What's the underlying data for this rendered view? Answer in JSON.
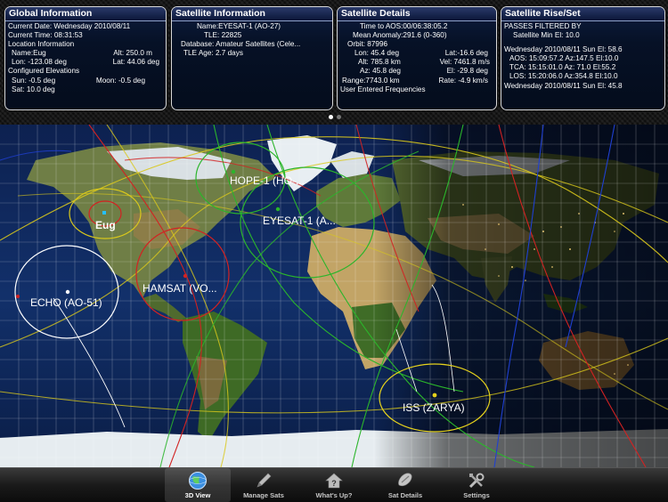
{
  "panels": {
    "global": {
      "title": "Global Information",
      "current_date": "Current Date: Wednesday 2010/08/11",
      "current_time": "Current Time: 08:31:53",
      "location_header": "Location Information",
      "name": "Name:Eug",
      "alt": "Alt:     250.0 m",
      "lon": "Lon: -123.08 deg",
      "lat": "Lat: 44.06 deg",
      "elev_header": "Configured Elevations",
      "sun": "Sun:  -0.5 deg",
      "moon": "Moon:  -0.5 deg",
      "sat": "Sat:  10.0 deg"
    },
    "satinfo": {
      "title": "Satellite Information",
      "name": "Name:EYESAT-1 (AO-27)",
      "tle": "TLE: 22825",
      "database": "Database: Amateur Satellites (Cele...",
      "tle_age": "TLE Age: 2.7 days"
    },
    "details": {
      "title": "Satellite Details",
      "time_to_aos": "Time to AOS:00/06:38:05.2",
      "mean_anomaly": "Mean Anomaly:291.6 (0-360)",
      "orbit": "Orbit:  87996",
      "lon": "Lon:  45.4 deg",
      "lat": "Lat:-16.6 deg",
      "alt": "Alt:  785.8 km",
      "vel": "Vel: 7461.8 m/s",
      "az": "Az: 45.8 deg",
      "el": "El: -29.8 deg",
      "range": "Range:7743.0 km",
      "rate": "Rate:   -4.9 km/s",
      "user_freq": "User Entered Frequencies"
    },
    "riseset": {
      "title": "Satellite Rise/Set",
      "filtered": "PASSES FILTERED BY",
      "min_el": "Satellite Min El:  10.0",
      "pass1": "Wednesday 2010/08/11 Sun El: 58.6",
      "aos1": "AOS: 15:09:57.2 Az:147.5 El:10.0",
      "tca1": "TCA: 15:15:01.0 Az: 71.0 El:55.2",
      "los1": "LOS: 15:20:06.0 Az:354.8 El:10.0",
      "pass2": "Wednesday 2010/08/11 Sun El: 45.8"
    }
  },
  "map": {
    "location_label": "Eug",
    "satellites": [
      {
        "name": "HOPE-1 (HO-...",
        "color": "#1f7a1f"
      },
      {
        "name": "EYESAT-1 (A...",
        "color": "#22aa22"
      },
      {
        "name": "HAMSAT (VO...",
        "color": "#d22222"
      },
      {
        "name": "ECHO (AO-51)",
        "color": "#ffffff"
      },
      {
        "name": "ISS (ZARYA)",
        "color": "#e6d21c"
      }
    ]
  },
  "tabs": [
    {
      "label": "3D View",
      "icon": "globe-icon",
      "selected": true
    },
    {
      "label": "Manage Sats",
      "icon": "pencil-icon"
    },
    {
      "label": "What's Up?",
      "icon": "house-question-icon"
    },
    {
      "label": "Sat Details",
      "icon": "satellite-icon"
    },
    {
      "label": "Settings",
      "icon": "tools-icon"
    }
  ]
}
